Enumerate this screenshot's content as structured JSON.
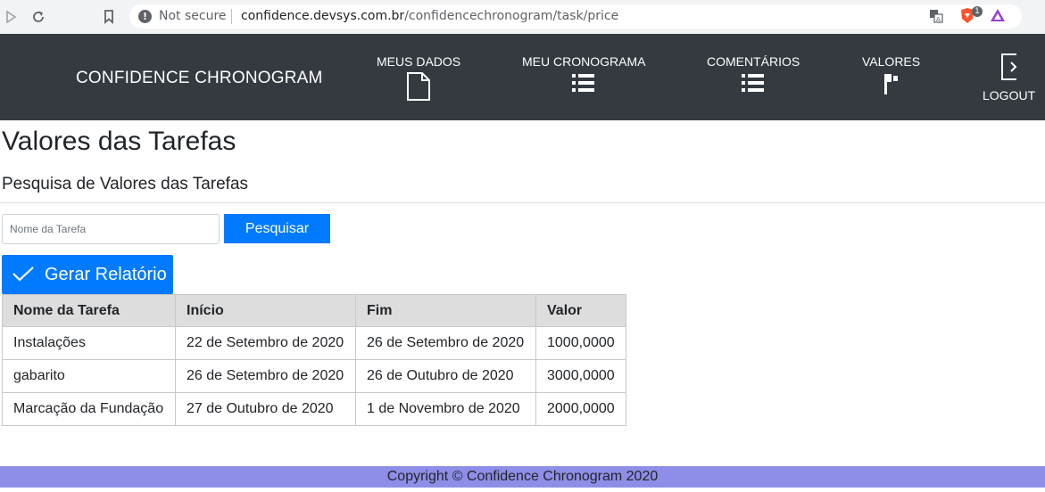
{
  "browser": {
    "security_label": "Not secure",
    "url_host": "confidence.devsys.com.br",
    "url_path": "/confidencechronogram/task/price",
    "brave_badge": "1"
  },
  "navbar": {
    "brand": "CONFIDENCE CHRONOGRAM",
    "items": [
      {
        "label": "MEUS DADOS",
        "icon": "document-icon"
      },
      {
        "label": "MEU CRONOGRAMA",
        "icon": "list-icon"
      },
      {
        "label": "COMENTÁRIOS",
        "icon": "list-icon"
      },
      {
        "label": "VALORES",
        "icon": "flag-icon"
      }
    ],
    "logout_label": "LOGOUT"
  },
  "main": {
    "title": "Valores das Tarefas",
    "subtitle": "Pesquisa de Valores das Tarefas",
    "search_placeholder": "Nome da Tarefa",
    "search_button": "Pesquisar",
    "report_button": "Gerar Relatório",
    "table": {
      "headers": [
        "Nome da Tarefa",
        "Início",
        "Fim",
        "Valor"
      ],
      "rows": [
        [
          "Instalações",
          "22 de Setembro de 2020",
          "26 de Setembro de 2020",
          "1000,0000"
        ],
        [
          "gabarito",
          "26 de Setembro de 2020",
          "26 de Outubro de 2020",
          "3000,0000"
        ],
        [
          "Marcação da Fundação",
          "27 de Outubro de 2020",
          "1 de Novembro de 2020",
          "2000,0000"
        ]
      ]
    }
  },
  "footer": {
    "text": "Copyright © Confidence Chronogram 2020"
  },
  "colors": {
    "navbar_bg": "#343a40",
    "primary": "#007bff",
    "footer_bg": "#8e8ee8",
    "table_header_bg": "#dddddd"
  }
}
